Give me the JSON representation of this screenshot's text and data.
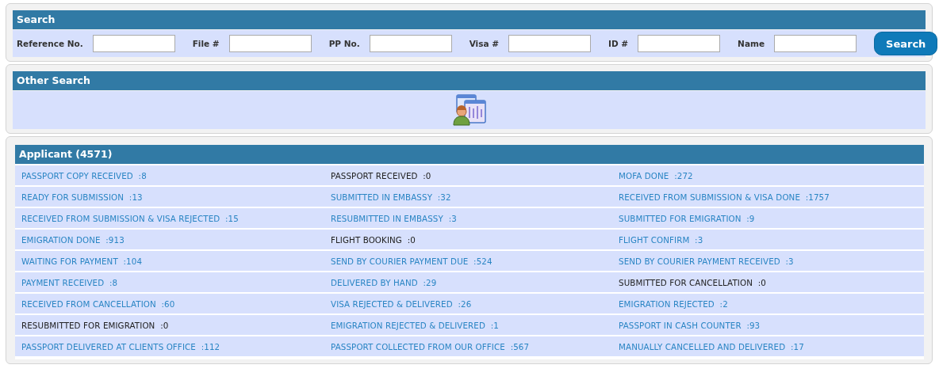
{
  "search": {
    "title": "Search",
    "fields": [
      {
        "label": "Reference No."
      },
      {
        "label": "File #"
      },
      {
        "label": "PP No."
      },
      {
        "label": "Visa #"
      },
      {
        "label": "ID #"
      },
      {
        "label": "Name"
      }
    ],
    "button": "Search"
  },
  "other_search": {
    "title": "Other Search"
  },
  "applicant": {
    "title": "Applicant (4571)",
    "items": [
      {
        "text": "PASSPORT COPY RECEIVED  :8",
        "disabled": false
      },
      {
        "text": "PASSPORT RECEIVED  :0",
        "disabled": true
      },
      {
        "text": "MOFA DONE  :272",
        "disabled": false
      },
      {
        "text": "READY FOR SUBMISSION  :13",
        "disabled": false
      },
      {
        "text": "SUBMITTED IN EMBASSY  :32",
        "disabled": false
      },
      {
        "text": "RECEIVED FROM SUBMISSION & VISA DONE  :1757",
        "disabled": false
      },
      {
        "text": "RECEIVED FROM SUBMISSION & VISA REJECTED  :15",
        "disabled": false
      },
      {
        "text": "RESUBMITTED IN EMBASSY  :3",
        "disabled": false
      },
      {
        "text": "SUBMITTED FOR EMIGRATION  :9",
        "disabled": false
      },
      {
        "text": "EMIGRATION DONE  :913",
        "disabled": false
      },
      {
        "text": "FLIGHT BOOKING  :0",
        "disabled": true
      },
      {
        "text": "FLIGHT CONFIRM  :3",
        "disabled": false
      },
      {
        "text": "WAITING FOR PAYMENT  :104",
        "disabled": false
      },
      {
        "text": "SEND BY COURIER PAYMENT DUE  :524",
        "disabled": false
      },
      {
        "text": "SEND BY COURIER PAYMENT RECEIVED  :3",
        "disabled": false
      },
      {
        "text": "PAYMENT RECEIVED  :8",
        "disabled": false
      },
      {
        "text": "DELIVERED BY HAND  :29",
        "disabled": false
      },
      {
        "text": "SUBMITTED FOR CANCELLATION  :0",
        "disabled": true
      },
      {
        "text": "RECEIVED FROM CANCELLATION  :60",
        "disabled": false
      },
      {
        "text": "VISA REJECTED & DELIVERED  :26",
        "disabled": false
      },
      {
        "text": "EMIGRATION REJECTED  :2",
        "disabled": false
      },
      {
        "text": "RESUBMITTED FOR EMIGRATION  :0",
        "disabled": true
      },
      {
        "text": "EMIGRATION REJECTED & DELIVERED  :1",
        "disabled": false
      },
      {
        "text": "PASSPORT IN CASH COUNTER  :93",
        "disabled": false
      },
      {
        "text": "PASSPORT DELIVERED AT CLIENTS OFFICE  :112",
        "disabled": false
      },
      {
        "text": "PASSPORT COLLECTED FROM OUR OFFICE  :567",
        "disabled": false
      },
      {
        "text": "MANUALLY CANCELLED AND DELIVERED  :17",
        "disabled": false
      }
    ]
  }
}
